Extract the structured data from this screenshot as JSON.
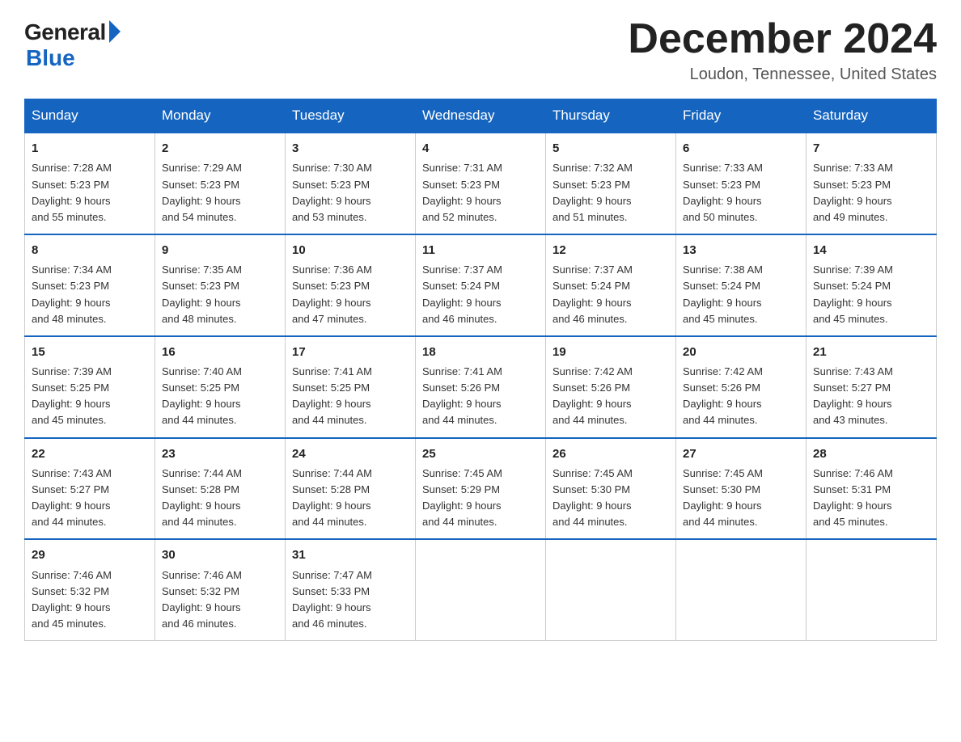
{
  "header": {
    "logo_general": "General",
    "logo_blue": "Blue",
    "month_title": "December 2024",
    "location": "Loudon, Tennessee, United States"
  },
  "weekdays": [
    "Sunday",
    "Monday",
    "Tuesday",
    "Wednesday",
    "Thursday",
    "Friday",
    "Saturday"
  ],
  "weeks": [
    [
      {
        "day": "1",
        "sunrise": "7:28 AM",
        "sunset": "5:23 PM",
        "daylight": "9 hours and 55 minutes."
      },
      {
        "day": "2",
        "sunrise": "7:29 AM",
        "sunset": "5:23 PM",
        "daylight": "9 hours and 54 minutes."
      },
      {
        "day": "3",
        "sunrise": "7:30 AM",
        "sunset": "5:23 PM",
        "daylight": "9 hours and 53 minutes."
      },
      {
        "day": "4",
        "sunrise": "7:31 AM",
        "sunset": "5:23 PM",
        "daylight": "9 hours and 52 minutes."
      },
      {
        "day": "5",
        "sunrise": "7:32 AM",
        "sunset": "5:23 PM",
        "daylight": "9 hours and 51 minutes."
      },
      {
        "day": "6",
        "sunrise": "7:33 AM",
        "sunset": "5:23 PM",
        "daylight": "9 hours and 50 minutes."
      },
      {
        "day": "7",
        "sunrise": "7:33 AM",
        "sunset": "5:23 PM",
        "daylight": "9 hours and 49 minutes."
      }
    ],
    [
      {
        "day": "8",
        "sunrise": "7:34 AM",
        "sunset": "5:23 PM",
        "daylight": "9 hours and 48 minutes."
      },
      {
        "day": "9",
        "sunrise": "7:35 AM",
        "sunset": "5:23 PM",
        "daylight": "9 hours and 48 minutes."
      },
      {
        "day": "10",
        "sunrise": "7:36 AM",
        "sunset": "5:23 PM",
        "daylight": "9 hours and 47 minutes."
      },
      {
        "day": "11",
        "sunrise": "7:37 AM",
        "sunset": "5:24 PM",
        "daylight": "9 hours and 46 minutes."
      },
      {
        "day": "12",
        "sunrise": "7:37 AM",
        "sunset": "5:24 PM",
        "daylight": "9 hours and 46 minutes."
      },
      {
        "day": "13",
        "sunrise": "7:38 AM",
        "sunset": "5:24 PM",
        "daylight": "9 hours and 45 minutes."
      },
      {
        "day": "14",
        "sunrise": "7:39 AM",
        "sunset": "5:24 PM",
        "daylight": "9 hours and 45 minutes."
      }
    ],
    [
      {
        "day": "15",
        "sunrise": "7:39 AM",
        "sunset": "5:25 PM",
        "daylight": "9 hours and 45 minutes."
      },
      {
        "day": "16",
        "sunrise": "7:40 AM",
        "sunset": "5:25 PM",
        "daylight": "9 hours and 44 minutes."
      },
      {
        "day": "17",
        "sunrise": "7:41 AM",
        "sunset": "5:25 PM",
        "daylight": "9 hours and 44 minutes."
      },
      {
        "day": "18",
        "sunrise": "7:41 AM",
        "sunset": "5:26 PM",
        "daylight": "9 hours and 44 minutes."
      },
      {
        "day": "19",
        "sunrise": "7:42 AM",
        "sunset": "5:26 PM",
        "daylight": "9 hours and 44 minutes."
      },
      {
        "day": "20",
        "sunrise": "7:42 AM",
        "sunset": "5:26 PM",
        "daylight": "9 hours and 44 minutes."
      },
      {
        "day": "21",
        "sunrise": "7:43 AM",
        "sunset": "5:27 PM",
        "daylight": "9 hours and 43 minutes."
      }
    ],
    [
      {
        "day": "22",
        "sunrise": "7:43 AM",
        "sunset": "5:27 PM",
        "daylight": "9 hours and 44 minutes."
      },
      {
        "day": "23",
        "sunrise": "7:44 AM",
        "sunset": "5:28 PM",
        "daylight": "9 hours and 44 minutes."
      },
      {
        "day": "24",
        "sunrise": "7:44 AM",
        "sunset": "5:28 PM",
        "daylight": "9 hours and 44 minutes."
      },
      {
        "day": "25",
        "sunrise": "7:45 AM",
        "sunset": "5:29 PM",
        "daylight": "9 hours and 44 minutes."
      },
      {
        "day": "26",
        "sunrise": "7:45 AM",
        "sunset": "5:30 PM",
        "daylight": "9 hours and 44 minutes."
      },
      {
        "day": "27",
        "sunrise": "7:45 AM",
        "sunset": "5:30 PM",
        "daylight": "9 hours and 44 minutes."
      },
      {
        "day": "28",
        "sunrise": "7:46 AM",
        "sunset": "5:31 PM",
        "daylight": "9 hours and 45 minutes."
      }
    ],
    [
      {
        "day": "29",
        "sunrise": "7:46 AM",
        "sunset": "5:32 PM",
        "daylight": "9 hours and 45 minutes."
      },
      {
        "day": "30",
        "sunrise": "7:46 AM",
        "sunset": "5:32 PM",
        "daylight": "9 hours and 46 minutes."
      },
      {
        "day": "31",
        "sunrise": "7:47 AM",
        "sunset": "5:33 PM",
        "daylight": "9 hours and 46 minutes."
      },
      null,
      null,
      null,
      null
    ]
  ],
  "labels": {
    "sunrise_prefix": "Sunrise: ",
    "sunset_prefix": "Sunset: ",
    "daylight_prefix": "Daylight: "
  }
}
